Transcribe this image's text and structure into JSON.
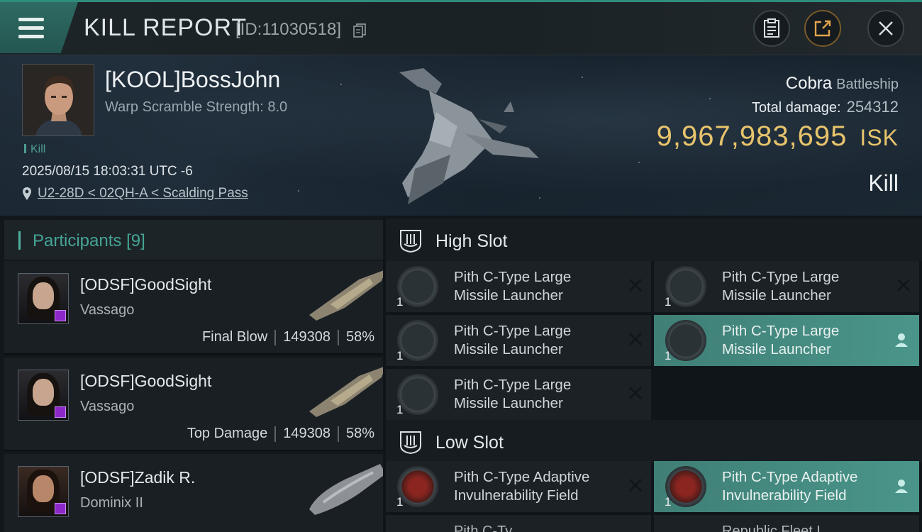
{
  "header": {
    "title": "KILL REPORT",
    "report_id": "[ID:11030518]"
  },
  "victim": {
    "name": "[KOOL]BossJohn",
    "warp_scramble": "Warp Scramble Strength: 8.0",
    "kill_tag": "Kill",
    "timestamp": "2025/08/15 18:03:31 UTC -6",
    "location": "U2-28D < 02QH-A < Scalding Pass",
    "ship_name": "Cobra",
    "ship_class": "Battleship",
    "total_damage_label": "Total damage:",
    "total_damage": "254312",
    "isk_value": "9,967,983,695",
    "isk_unit": "ISK",
    "result": "Kill"
  },
  "participants": {
    "label": "Participants",
    "count": "[9]",
    "items": [
      {
        "name": "[ODSF]GoodSight",
        "ship": "Vassago",
        "role": "Final Blow",
        "damage": "149308",
        "percent": "58%"
      },
      {
        "name": "[ODSF]GoodSight",
        "ship": "Vassago",
        "role": "Top Damage",
        "damage": "149308",
        "percent": "58%"
      },
      {
        "name": "[ODSF]Zadik R.",
        "ship": "Dominix II"
      }
    ]
  },
  "fitting": {
    "high_slot_label": "High Slot",
    "low_slot_label": "Low Slot",
    "high_slot": [
      {
        "line1": "Pith C-Type Large",
        "line2": "Missile Launcher",
        "qty": "1",
        "state": "destroyed"
      },
      {
        "line1": "Pith C-Type Large",
        "line2": "Missile Launcher",
        "qty": "1",
        "state": "destroyed"
      },
      {
        "line1": "Pith C-Type Large",
        "line2": "Missile Launcher",
        "qty": "1",
        "state": "destroyed"
      },
      {
        "line1": "Pith C-Type Large",
        "line2": "Missile Launcher",
        "qty": "1",
        "state": "dropped"
      },
      {
        "line1": "Pith C-Type Large",
        "line2": "Missile Launcher",
        "qty": "1",
        "state": "destroyed"
      }
    ],
    "low_slot": [
      {
        "line1": "Pith C-Type Adaptive",
        "line2": "Invulnerability Field",
        "qty": "1",
        "state": "destroyed"
      },
      {
        "line1": "Pith C-Type Adaptive",
        "line2": "Invulnerability Field",
        "qty": "1",
        "state": "dropped"
      }
    ],
    "low_slot_peek": [
      "Pith C-Ty",
      "Republic Fleet L"
    ]
  },
  "colors": {
    "accent_teal": "#2f8d7c",
    "isk_gold": "#e8c46c",
    "active_slot": "#4a958a",
    "badge_purple": "#8c28c8"
  },
  "icons": {
    "menu": "hamburger-icon",
    "copy": "copy-icon",
    "clipboard": "clipboard-icon",
    "share": "share-icon",
    "close": "close-icon",
    "location": "location-pin-icon",
    "slot": "high-slot-icon",
    "destroyed": "x-mark-icon",
    "dropped": "pilot-icon"
  }
}
